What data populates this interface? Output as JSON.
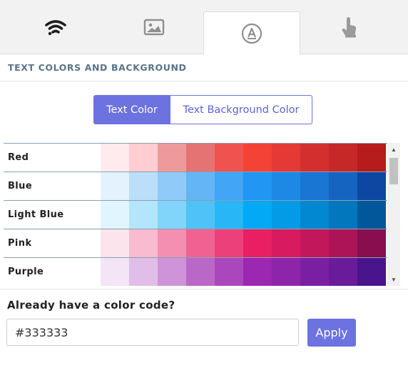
{
  "tabs": [
    {
      "name": "wifi-tab",
      "icon": "wifi-icon"
    },
    {
      "name": "image-tab",
      "icon": "image-icon"
    },
    {
      "name": "text-color-tab",
      "icon": "text-a-icon",
      "active": true
    },
    {
      "name": "touch-tab",
      "icon": "touch-hand-icon"
    }
  ],
  "section_title": "TEXT COLORS AND BACKGROUND",
  "toggle": {
    "text_color": "Text Color",
    "text_background_color": "Text Background Color",
    "active": "text_color"
  },
  "palette": [
    {
      "label": "Red",
      "colors": [
        "#ffebee",
        "#ffcdd2",
        "#ef9a9a",
        "#e57373",
        "#ef5350",
        "#f44336",
        "#e53935",
        "#d32f2f",
        "#c62828",
        "#b71c1c"
      ]
    },
    {
      "label": "Blue",
      "colors": [
        "#e3f2fd",
        "#bbdefb",
        "#90caf9",
        "#64b5f6",
        "#42a5f5",
        "#2196f3",
        "#1e88e5",
        "#1976d2",
        "#1565c0",
        "#0d47a1"
      ]
    },
    {
      "label": "Light Blue",
      "colors": [
        "#e1f5fe",
        "#b3e5fc",
        "#81d4fa",
        "#4fc3f7",
        "#29b6f6",
        "#03a9f4",
        "#039be5",
        "#0288d1",
        "#0277bd",
        "#01579b"
      ]
    },
    {
      "label": "Pink",
      "colors": [
        "#fce4ec",
        "#f8bbd0",
        "#f48fb1",
        "#f06292",
        "#ec407a",
        "#e91e63",
        "#d81b60",
        "#c2185b",
        "#ad1457",
        "#880e4f"
      ]
    },
    {
      "label": "Purple",
      "colors": [
        "#f3e5f5",
        "#e1bee7",
        "#ce93d8",
        "#ba68c8",
        "#ab47bc",
        "#9c27b0",
        "#8e24aa",
        "#7b1fa2",
        "#6a1b9a",
        "#4a148c"
      ]
    }
  ],
  "color_code": {
    "label": "Already have a color code?",
    "value": "#333333",
    "apply_label": "Apply"
  },
  "colors": {
    "accent": "#6c72e0",
    "section_title": "#5b7388",
    "icon": "#3a3a3a",
    "icon_muted": "#9a9a9a"
  }
}
